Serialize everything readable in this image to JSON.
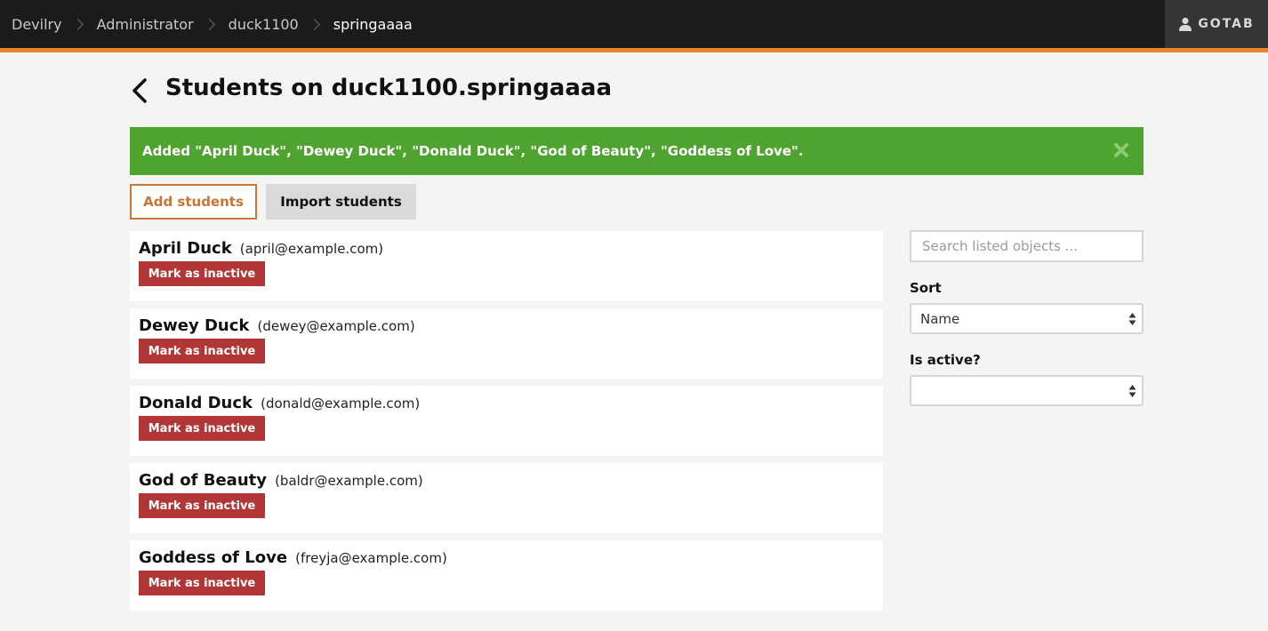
{
  "breadcrumb": {
    "items": [
      {
        "label": "Devilry"
      },
      {
        "label": "Administrator"
      },
      {
        "label": "duck1100"
      },
      {
        "label": "springaaaa"
      }
    ]
  },
  "user": {
    "label": "GOTAB",
    "icon": "user-icon"
  },
  "page": {
    "title": "Students on duck1100.springaaaa",
    "back_icon": "chevron-left-icon"
  },
  "alert": {
    "message": "Added \"April Duck\", \"Dewey Duck\", \"Donald Duck\", \"God of Beauty\", \"Goddess of Love\".",
    "color": "#4fa32f",
    "close_icon": "close-icon"
  },
  "actions": {
    "add_label": "Add students",
    "import_label": "Import students"
  },
  "students": [
    {
      "name": "April Duck",
      "email": "(april@example.com)",
      "action": "Mark as inactive"
    },
    {
      "name": "Dewey Duck",
      "email": "(dewey@example.com)",
      "action": "Mark as inactive"
    },
    {
      "name": "Donald Duck",
      "email": "(donald@example.com)",
      "action": "Mark as inactive"
    },
    {
      "name": "God of Beauty",
      "email": "(baldr@example.com)",
      "action": "Mark as inactive"
    },
    {
      "name": "Goddess of Love",
      "email": "(freyja@example.com)",
      "action": "Mark as inactive"
    }
  ],
  "sidebar": {
    "search_placeholder": "Search listed objects ...",
    "sort_label": "Sort",
    "sort_value": "Name",
    "active_label": "Is active?",
    "active_value": ""
  },
  "colors": {
    "accent": "#e8852a",
    "danger": "#b33636",
    "success": "#4fa32f",
    "add_button": "#c8763a"
  }
}
